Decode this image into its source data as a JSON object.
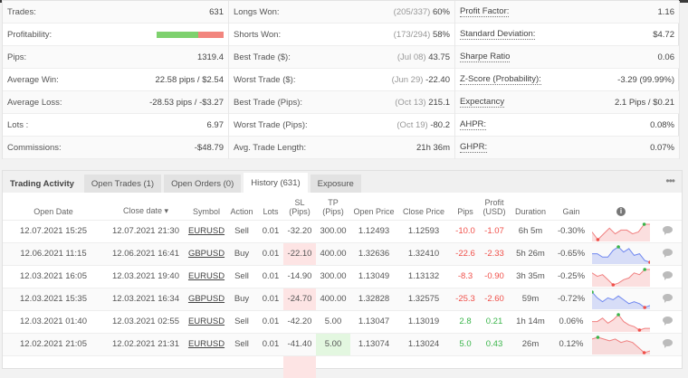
{
  "stats": {
    "col1": [
      {
        "label": "Trades:",
        "value": "631"
      },
      {
        "label": "Profitability:",
        "bar": {
          "win_fraction": 0.62
        }
      },
      {
        "label": "Pips:",
        "value": "1319.4"
      },
      {
        "label": "Average Win:",
        "value": "22.58 pips / $2.54"
      },
      {
        "label": "Average Loss:",
        "value": "-28.53 pips / -$3.27"
      },
      {
        "label": "Lots :",
        "value": "6.97"
      },
      {
        "label": "Commissions:",
        "value": "-$48.79"
      }
    ],
    "col2": [
      {
        "label": "Longs Won:",
        "muted": "(205/337)",
        "value": "60%"
      },
      {
        "label": "Shorts Won:",
        "muted": "(173/294)",
        "value": "58%"
      },
      {
        "label": "Best Trade ($):",
        "muted": "(Jul 08)",
        "value": "43.75"
      },
      {
        "label": "Worst Trade ($):",
        "muted": "(Jun 29)",
        "value": "-22.40"
      },
      {
        "label": "Best Trade (Pips):",
        "muted": "(Oct 13)",
        "value": "215.1"
      },
      {
        "label": "Worst Trade (Pips):",
        "muted": "(Oct 19)",
        "value": "-80.2"
      },
      {
        "label": "Avg. Trade Length:",
        "muted": "",
        "value": "21h 36m"
      }
    ],
    "col3": [
      {
        "label": "Profit Factor:",
        "value": "1.16"
      },
      {
        "label": "Standard Deviation:",
        "value": "$4.72"
      },
      {
        "label": "Sharpe Ratio",
        "value": "0.06"
      },
      {
        "label": "Z-Score (Probability):",
        "value": "-3.29 (99.99%)"
      },
      {
        "label": "Expectancy",
        "value": "2.1 Pips / $0.21"
      },
      {
        "label": "AHPR:",
        "value": "0.08%"
      },
      {
        "label": "GHPR:",
        "value": "0.07%"
      }
    ]
  },
  "tabs": {
    "title": "Trading Activity",
    "items": [
      "Open Trades (1)",
      "Open Orders (0)",
      "History (631)",
      "Exposure"
    ],
    "active": 2,
    "more": "•••"
  },
  "columns": {
    "open_date": "Open Date",
    "close_date": "Close date ▾",
    "symbol": "Symbol",
    "action": "Action",
    "lots": "Lots",
    "sl1": "SL",
    "sl2": "(Pips)",
    "tp1": "TP",
    "tp2": "(Pips)",
    "open_price": "Open Price",
    "close_price": "Close Price",
    "pips": "Pips",
    "profit1": "Profit",
    "profit2": "(USD)",
    "duration": "Duration",
    "gain": "Gain",
    "info": "i"
  },
  "rows": [
    {
      "open": "12.07.2021 15:25",
      "close": "12.07.2021 21:30",
      "symbol": "EURUSD",
      "action": "Sell",
      "lots": "0.01",
      "sl": "-32.20",
      "tp": "300.00",
      "op": "1.12493",
      "cp": "1.12593",
      "pips": "-10.0",
      "profit": "-1.07",
      "duration": "6h 5m",
      "gain": "-0.30%",
      "sl_hit": false,
      "tp_hit": false,
      "spark": {
        "color": "#f08080",
        "values": [
          5,
          1,
          4,
          7,
          4,
          6,
          6,
          4,
          5,
          9,
          9
        ]
      }
    },
    {
      "open": "12.06.2021 11:15",
      "close": "12.06.2021 16:41",
      "symbol": "GBPUSD",
      "action": "Buy",
      "lots": "0.01",
      "sl": "-22.10",
      "tp": "400.00",
      "op": "1.32636",
      "cp": "1.32410",
      "pips": "-22.6",
      "profit": "-2.33",
      "duration": "5h 26m",
      "gain": "-0.65%",
      "sl_hit": true,
      "tp_hit": false,
      "spark": {
        "color": "#7088f0",
        "values": [
          5,
          5,
          3,
          3,
          7,
          9,
          6,
          8,
          4,
          5,
          1,
          0
        ]
      }
    },
    {
      "open": "12.03.2021 16:05",
      "close": "12.03.2021 19:40",
      "symbol": "EURUSD",
      "action": "Sell",
      "lots": "0.01",
      "sl": "-14.90",
      "tp": "300.00",
      "op": "1.13049",
      "cp": "1.13132",
      "pips": "-8.3",
      "profit": "-0.90",
      "duration": "3h 35m",
      "gain": "-0.25%",
      "sl_hit": false,
      "tp_hit": false,
      "spark": {
        "color": "#f08080",
        "values": [
          7,
          5,
          6,
          3,
          0,
          1,
          3,
          4,
          7,
          6,
          9,
          9
        ]
      }
    },
    {
      "open": "12.03.2021 15:35",
      "close": "12.03.2021 16:34",
      "symbol": "GBPUSD",
      "action": "Buy",
      "lots": "0.01",
      "sl": "-24.70",
      "tp": "400.00",
      "op": "1.32828",
      "cp": "1.32575",
      "pips": "-25.3",
      "profit": "-2.60",
      "duration": "59m",
      "gain": "-0.72%",
      "sl_hit": true,
      "tp_hit": false,
      "spark": {
        "color": "#7088f0",
        "values": [
          9,
          6,
          4,
          6,
          5,
          7,
          5,
          3,
          4,
          3,
          1,
          2
        ]
      }
    },
    {
      "open": "12.03.2021 01:40",
      "close": "12.03.2021 02:55",
      "symbol": "EURUSD",
      "action": "Sell",
      "lots": "0.01",
      "sl": "-42.20",
      "tp": "5.00",
      "op": "1.13047",
      "cp": "1.13019",
      "pips": "2.8",
      "profit": "0.21",
      "duration": "1h 14m",
      "gain": "0.06%",
      "sl_hit": false,
      "tp_hit": false,
      "spark": {
        "color": "#f08080",
        "values": [
          5,
          5,
          7,
          4,
          6,
          9,
          5,
          3,
          2,
          0,
          1,
          1
        ]
      }
    },
    {
      "open": "12.02.2021 21:05",
      "close": "12.02.2021 21:31",
      "symbol": "EURUSD",
      "action": "Sell",
      "lots": "0.01",
      "sl": "-41.40",
      "tp": "5.00",
      "op": "1.13074",
      "cp": "1.13024",
      "pips": "5.0",
      "profit": "0.43",
      "duration": "26m",
      "gain": "0.12%",
      "sl_hit": false,
      "tp_hit": true,
      "spark": {
        "color": "#f08080",
        "values": [
          8,
          9,
          8,
          7,
          8,
          6,
          7,
          6,
          3,
          0,
          1
        ]
      }
    }
  ]
}
